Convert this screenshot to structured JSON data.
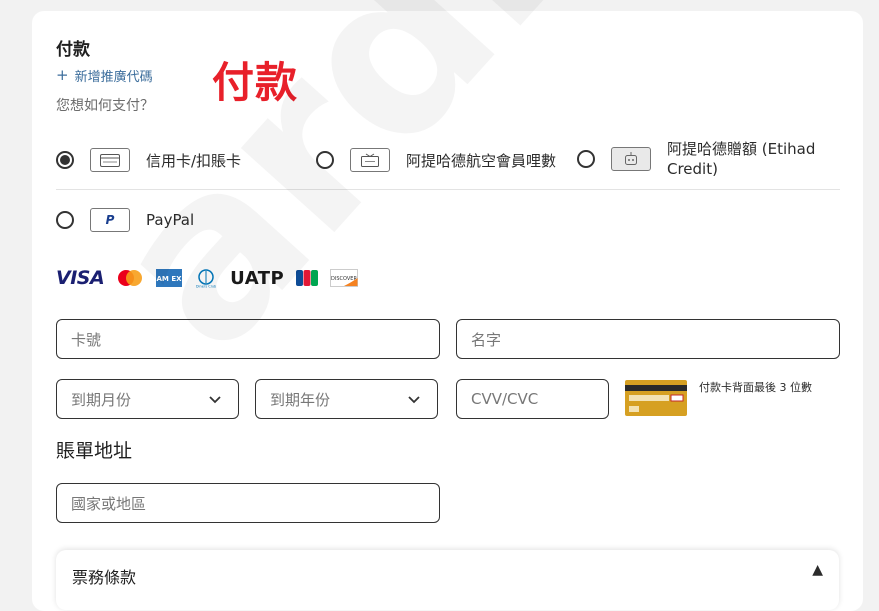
{
  "payment": {
    "title": "付款",
    "overlay_title": "付款",
    "add_promo": "新增推廣代碼",
    "question": "您想如何支付？",
    "options": [
      {
        "label": "信用卡/扣賬卡",
        "selected": true,
        "icon": "credit-card-icon"
      },
      {
        "label": "阿提哈德航空會員哩數",
        "selected": false,
        "icon": "miles-ticket-icon"
      },
      {
        "label": "阿提哈德贈額 (Etihad Credit)",
        "selected": false,
        "icon": "etihad-credit-icon"
      },
      {
        "label": "PayPal",
        "selected": false,
        "icon": "paypal-icon"
      }
    ],
    "card_brands": [
      "VISA",
      "Mastercard",
      "AMEX",
      "Diners Club",
      "UATP",
      "JCB",
      "DISCOVER"
    ]
  },
  "form": {
    "card_number_placeholder": "卡號",
    "name_placeholder": "名字",
    "expiry_month_placeholder": "到期月份",
    "expiry_year_placeholder": "到期年份",
    "cvv_placeholder": "CVV/CVC",
    "cvv_hint": "付款卡背面最後 3 位數"
  },
  "billing": {
    "heading": "賬單地址",
    "country_placeholder": "國家或地區"
  },
  "bottom_section": {
    "title": "票務條款"
  },
  "watermark": "ardingw",
  "colors": {
    "accent": "#e8202a",
    "link": "#3d6e9c",
    "border": "#333333"
  }
}
